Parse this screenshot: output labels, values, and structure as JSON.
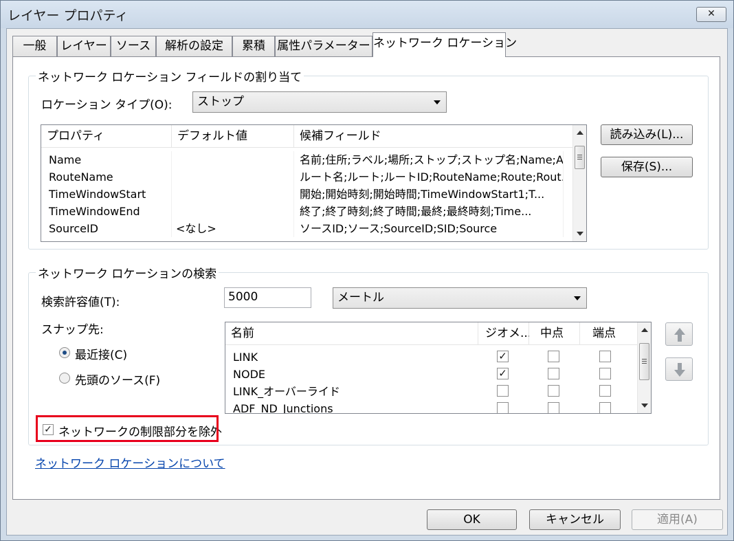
{
  "window": {
    "title": "レイヤー プロパティ",
    "close_glyph": "✕"
  },
  "tabs": [
    "一般",
    "レイヤー",
    "ソース",
    "解析の設定",
    "累積",
    "属性パラメーター",
    "ネットワーク ロケーション"
  ],
  "active_tab_index": 6,
  "field_mapping": {
    "group_title": "ネットワーク ロケーション フィールドの割り当て",
    "location_type_label": "ロケーション タイプ(O):",
    "location_type_value": "ストップ",
    "columns": [
      "プロパティ",
      "デフォルト値",
      "候補フィールド"
    ],
    "rows": [
      {
        "property": "Name",
        "default": "",
        "candidates": "名前;住所;ラベル;場所;ストップ;ストップ名;Name;Ad..."
      },
      {
        "property": "RouteName",
        "default": "",
        "candidates": "ルート名;ルート;ルートID;RouteName;Route;Rout..."
      },
      {
        "property": "TimeWindowStart",
        "default": "",
        "candidates": "開始;開始時刻;開始時間;TimeWindowStart1;T..."
      },
      {
        "property": "TimeWindowEnd",
        "default": "",
        "candidates": "終了;終了時刻;終了時間;最終;最終時刻;Time..."
      },
      {
        "property": "SourceID",
        "default": "<なし>",
        "candidates": "ソースID;ソース;SourceID;SID;Source"
      }
    ],
    "load_button": "読み込み(L)...",
    "save_button": "保存(S)..."
  },
  "search": {
    "group_title": "ネットワーク ロケーションの検索",
    "tolerance_label": "検索許容値(T):",
    "tolerance_value": "5000",
    "unit_value": "メートル",
    "snap_label": "スナップ先:",
    "radio_closest": "最近接(C)",
    "radio_first_source": "先頭のソース(F)",
    "selected_radio": "closest",
    "columns": [
      "名前",
      "ジオメ...",
      "中点",
      "端点"
    ],
    "sources": [
      {
        "name": "LINK",
        "geometry": true,
        "midpoint": false,
        "endpoint": false
      },
      {
        "name": "NODE",
        "geometry": true,
        "midpoint": false,
        "endpoint": false
      },
      {
        "name": "LINK_オーバーライド",
        "geometry": false,
        "midpoint": false,
        "endpoint": false
      },
      {
        "name": "ADF_ND_Junctions",
        "geometry": false,
        "midpoint": false,
        "endpoint": false
      }
    ],
    "exclude_restricted_label": "ネットワークの制限部分を除外",
    "exclude_restricted_checked": true,
    "move_up_icon": "arrow-up-icon",
    "move_down_icon": "arrow-down-icon"
  },
  "about_link": "ネットワーク ロケーションについて",
  "footer": {
    "ok": "OK",
    "cancel": "キャンセル",
    "apply": "適用(A)"
  },
  "colors": {
    "highlight_box": "#e8001c",
    "link": "#0645ad"
  }
}
